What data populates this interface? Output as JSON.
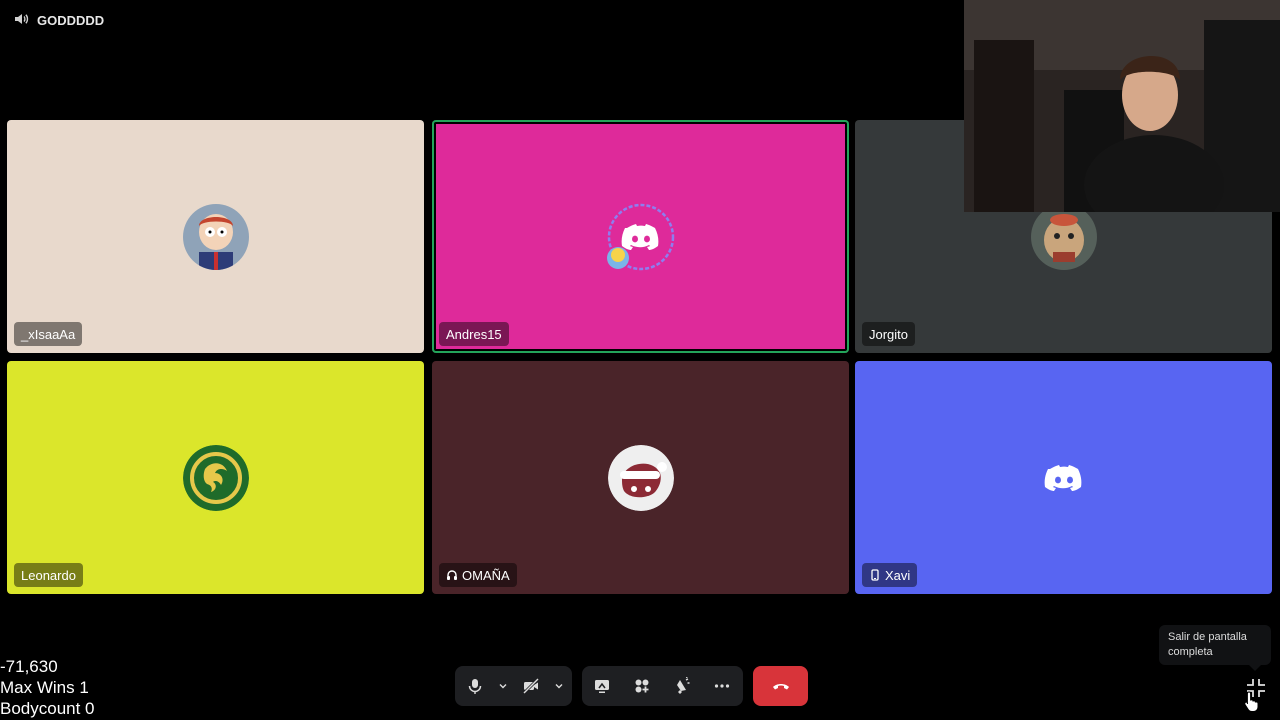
{
  "channel": {
    "name": "GODDDDD",
    "icon": "speaker-icon"
  },
  "tiles": [
    {
      "name": "_xIsaaAa",
      "bg": "#e8d9cc",
      "avatar": "cartoon-boy-avatar",
      "speaking": false
    },
    {
      "name": "Andres15",
      "bg": "#de2a9a",
      "avatar": "discord-logo-avatar",
      "speaking": true
    },
    {
      "name": "Jorgito",
      "bg": "#35393a",
      "avatar": "creature-avatar",
      "speaking": false
    },
    {
      "name": "Leonardo",
      "bg": "#dbe62b",
      "avatar": "dragon-emblem-avatar",
      "speaking": false
    },
    {
      "name": "OMAÑA",
      "bg": "#4a2429",
      "avatar": "santa-hat-avatar",
      "speaking": false,
      "badge": "headset-icon"
    },
    {
      "name": "Xavi",
      "bg": "#5865f2",
      "avatar": "discord-logo-avatar",
      "speaking": false,
      "badge": "mobile-icon"
    }
  ],
  "stats": {
    "score": "-71,630",
    "max_wins": "Max Wins 1",
    "bodycount": "Bodycount 0"
  },
  "controls": {
    "buttons": [
      "microphone-icon",
      "camera-off-icon",
      "screen-share-icon",
      "activities-icon",
      "soundboard-icon",
      "more-icon"
    ],
    "hangup": "hangup-icon"
  },
  "tooltip": {
    "text": "Salir de pantalla completa"
  },
  "colors": {
    "speaking_ring": "#23a55a",
    "hangup": "#d8343a",
    "control_bg": "#1e1f22"
  }
}
